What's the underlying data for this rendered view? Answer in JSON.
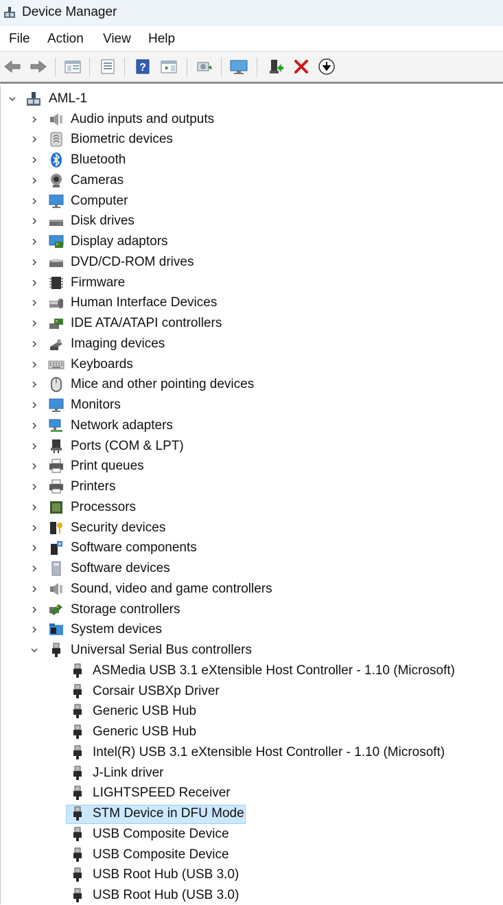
{
  "window": {
    "title": "Device Manager"
  },
  "menu": {
    "items": [
      "File",
      "Action",
      "View",
      "Help"
    ]
  },
  "toolbar": {
    "icons": [
      "back-icon",
      "forward-icon",
      "show-hide-console-tree-icon",
      "properties-icon",
      "help-icon",
      "action-pane-icon",
      "scan-hardware-changes-icon",
      "monitor-icon",
      "update-driver-icon",
      "uninstall-icon",
      "disable-icon"
    ]
  },
  "tree": {
    "root": "AML-1",
    "categories": [
      {
        "label": "Audio inputs and outputs",
        "icon": "speaker-icon"
      },
      {
        "label": "Biometric devices",
        "icon": "fingerprint-icon"
      },
      {
        "label": "Bluetooth",
        "icon": "bluetooth-icon"
      },
      {
        "label": "Cameras",
        "icon": "camera-icon"
      },
      {
        "label": "Computer",
        "icon": "computer-icon"
      },
      {
        "label": "Disk drives",
        "icon": "disk-drive-icon"
      },
      {
        "label": "Display adaptors",
        "icon": "display-adapter-icon"
      },
      {
        "label": "DVD/CD-ROM drives",
        "icon": "dvd-drive-icon"
      },
      {
        "label": "Firmware",
        "icon": "chip-icon"
      },
      {
        "label": "Human Interface Devices",
        "icon": "hid-icon"
      },
      {
        "label": "IDE ATA/ATAPI controllers",
        "icon": "ide-controller-icon"
      },
      {
        "label": "Imaging devices",
        "icon": "imaging-icon"
      },
      {
        "label": "Keyboards",
        "icon": "keyboard-icon"
      },
      {
        "label": "Mice and other pointing devices",
        "icon": "mouse-icon"
      },
      {
        "label": "Monitors",
        "icon": "monitor-icon"
      },
      {
        "label": "Network adapters",
        "icon": "network-icon"
      },
      {
        "label": "Ports (COM & LPT)",
        "icon": "port-icon"
      },
      {
        "label": "Print queues",
        "icon": "printer-icon"
      },
      {
        "label": "Printers",
        "icon": "printer-icon"
      },
      {
        "label": "Processors",
        "icon": "processor-icon"
      },
      {
        "label": "Security devices",
        "icon": "security-key-icon"
      },
      {
        "label": "Software components",
        "icon": "software-component-icon"
      },
      {
        "label": "Software devices",
        "icon": "software-device-icon"
      },
      {
        "label": "Sound, video and game controllers",
        "icon": "speaker-icon"
      },
      {
        "label": "Storage controllers",
        "icon": "storage-controller-icon"
      },
      {
        "label": "System devices",
        "icon": "system-folder-icon"
      },
      {
        "label": "Universal Serial Bus controllers",
        "icon": "usb-plug-icon"
      }
    ],
    "usb_children": [
      "ASMedia USB 3.1 eXtensible Host Controller - 1.10 (Microsoft)",
      "Corsair USBXp Driver",
      "Generic USB Hub",
      "Generic USB Hub",
      "Intel(R) USB 3.1 eXtensible Host Controller - 1.10 (Microsoft)",
      "J-Link driver",
      "LIGHTSPEED Receiver",
      "STM Device in DFU Mode",
      "USB Composite Device",
      "USB Composite Device",
      "USB Root Hub (USB 3.0)",
      "USB Root Hub (USB 3.0)"
    ],
    "selected": "STM Device in DFU Mode"
  },
  "colors": {
    "selection_bg": "#cce8ff",
    "selection_border": "#99d1ff",
    "title_bg": "#eef4f9"
  }
}
